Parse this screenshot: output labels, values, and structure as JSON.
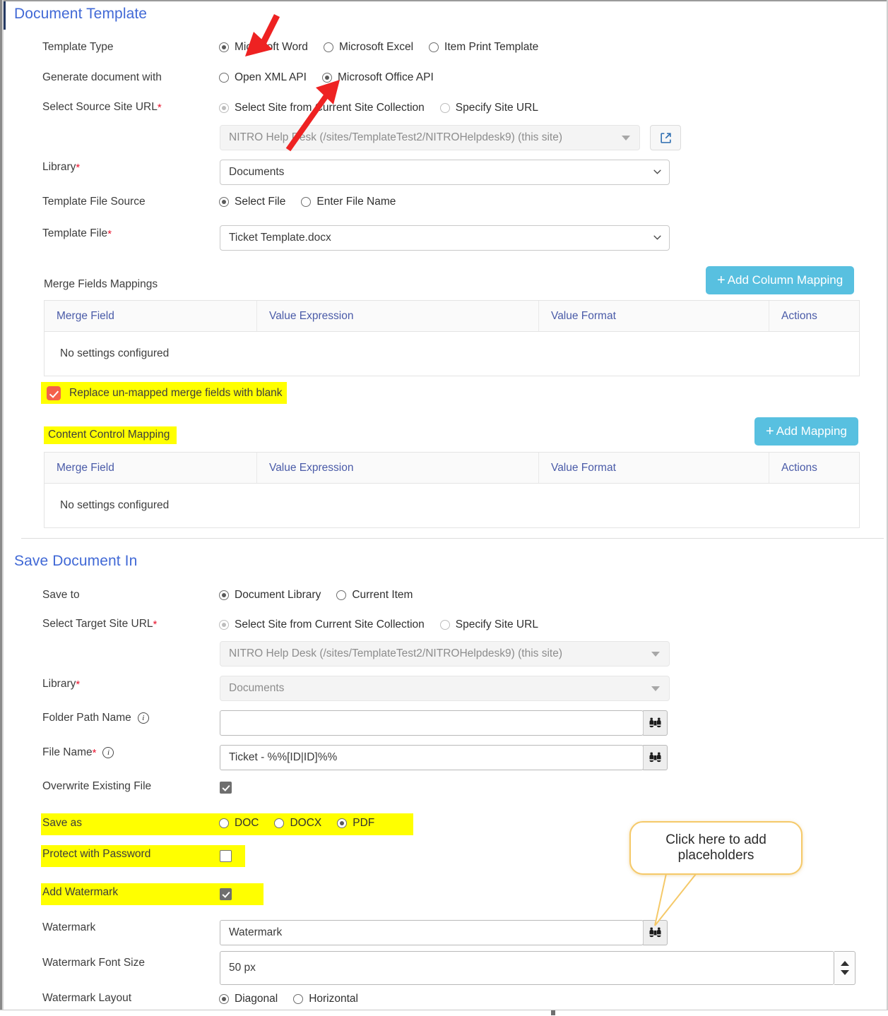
{
  "sections": {
    "document_template": {
      "title": "Document Template",
      "template_type": {
        "label": "Template Type",
        "options": [
          {
            "label": "Microsoft Word",
            "selected": true
          },
          {
            "label": "Microsoft Excel",
            "selected": false
          },
          {
            "label": "Item Print Template",
            "selected": false
          }
        ]
      },
      "generate_with": {
        "label": "Generate document with",
        "options": [
          {
            "label": "Open XML API",
            "selected": false
          },
          {
            "label": "Microsoft Office API",
            "selected": true
          }
        ]
      },
      "source_site": {
        "label": "Select Source Site URL",
        "required": "*",
        "options": [
          {
            "label": "Select Site from Current Site Collection",
            "selected": true
          },
          {
            "label": "Specify Site URL",
            "selected": false
          }
        ],
        "value": "NITRO Help Desk (/sites/TemplateTest2/NITROHelpdesk9) (this site)"
      },
      "library": {
        "label": "Library",
        "required": "*",
        "value": "Documents"
      },
      "template_file_source": {
        "label": "Template File Source",
        "options": [
          {
            "label": "Select File",
            "selected": true
          },
          {
            "label": "Enter File Name",
            "selected": false
          }
        ]
      },
      "template_file": {
        "label": "Template File",
        "required": "*",
        "value": "Ticket Template.docx"
      },
      "merge_fields": {
        "label": "Merge Fields Mappings",
        "add_button": "Add Column Mapping",
        "columns": [
          "Merge Field",
          "Value Expression",
          "Value Format",
          "Actions"
        ],
        "empty_text": "No settings configured"
      },
      "replace_unmapped": {
        "label": "Replace un-mapped merge fields with blank",
        "checked": true,
        "highlighted": true
      },
      "content_control": {
        "label": "Content Control Mapping",
        "highlighted": true,
        "add_button": "Add Mapping",
        "columns": [
          "Merge Field",
          "Value Expression",
          "Value Format",
          "Actions"
        ],
        "empty_text": "No settings configured"
      }
    },
    "save_document_in": {
      "title": "Save Document In",
      "save_to": {
        "label": "Save to",
        "options": [
          {
            "label": "Document Library",
            "selected": true
          },
          {
            "label": "Current Item",
            "selected": false
          }
        ]
      },
      "target_site": {
        "label": "Select Target Site URL",
        "required": "*",
        "options": [
          {
            "label": "Select Site from Current Site Collection",
            "selected": true
          },
          {
            "label": "Specify Site URL",
            "selected": false
          }
        ],
        "value": "NITRO Help Desk (/sites/TemplateTest2/NITROHelpdesk9) (this site)"
      },
      "library": {
        "label": "Library",
        "required": "*",
        "value": "Documents"
      },
      "folder_path": {
        "label": "Folder Path Name",
        "value": ""
      },
      "file_name": {
        "label": "File Name",
        "required": "*",
        "value": "Ticket - %%[ID|ID]%%"
      },
      "overwrite": {
        "label": "Overwrite Existing File",
        "checked": true
      },
      "save_as": {
        "label": "Save as",
        "highlighted": true,
        "options": [
          {
            "label": "DOC",
            "selected": false
          },
          {
            "label": "DOCX",
            "selected": false
          },
          {
            "label": "PDF",
            "selected": true
          }
        ]
      },
      "protect_password": {
        "label": "Protect with Password",
        "checked": false,
        "highlighted": true
      },
      "add_watermark": {
        "label": "Add Watermark",
        "checked": true,
        "highlighted": true
      },
      "watermark": {
        "label": "Watermark",
        "value": "Watermark"
      },
      "watermark_font_size": {
        "label": "Watermark Font Size",
        "value": "50 px"
      },
      "watermark_layout": {
        "label": "Watermark Layout",
        "options": [
          {
            "label": "Diagonal",
            "selected": true
          },
          {
            "label": "Horizontal",
            "selected": false
          }
        ]
      }
    }
  },
  "annotations": {
    "callout_text": "Click here to add placeholders",
    "arrow_color": "#ee2222",
    "callout_border_color": "#f5c969",
    "highlight_color": "#ffff00",
    "accent_button_color": "#58c0e0",
    "section_title_color": "#4169d6"
  }
}
